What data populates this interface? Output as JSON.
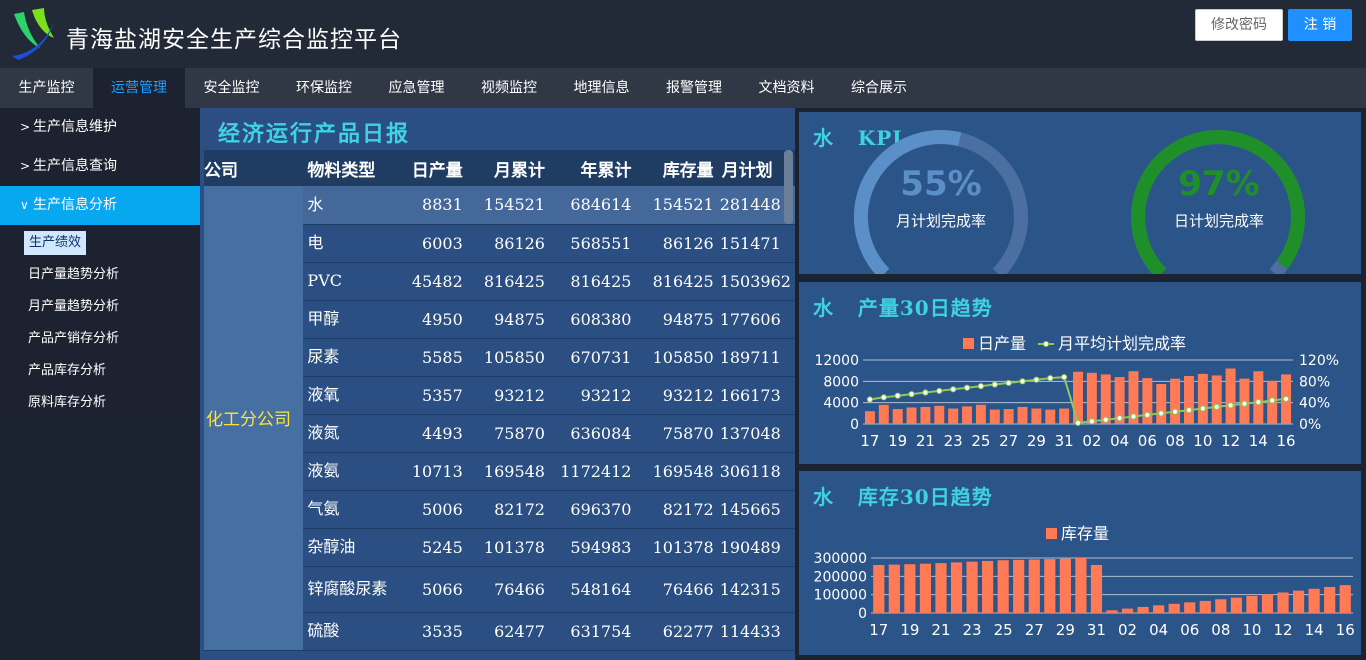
{
  "header": {
    "title": "青海盐湖安全生产综合监控平台",
    "btn_pwd": "修改密码",
    "btn_logout": "注 销"
  },
  "nav": [
    "生产监控",
    "运营管理",
    "安全监控",
    "环保监控",
    "应急管理",
    "视频监控",
    "地理信息",
    "报警管理",
    "文档资料",
    "综合展示"
  ],
  "sidebar": {
    "groups": [
      "生产信息维护",
      "生产信息查询",
      "生产信息分析"
    ],
    "sub": [
      "生产绩效",
      "日产量趋势分析",
      "月产量趋势分析",
      "产品产销存分析",
      "产品库存分析",
      "原料库存分析"
    ]
  },
  "report": {
    "title": "经济运行产品日报",
    "columns": [
      "公司",
      "物料类型",
      "日产量",
      "月累计",
      "年累计",
      "库存量",
      "月计划"
    ],
    "company": "化工分公司",
    "rows": [
      [
        "水",
        "8831",
        "154521",
        "684614",
        "154521",
        "281448"
      ],
      [
        "电",
        "6003",
        "86126",
        "568551",
        "86126",
        "151471"
      ],
      [
        "PVC",
        "45482",
        "816425",
        "816425",
        "816425",
        "1503962"
      ],
      [
        "甲醇",
        "4950",
        "94875",
        "608380",
        "94875",
        "177606"
      ],
      [
        "尿素",
        "5585",
        "105850",
        "670731",
        "105850",
        "189711"
      ],
      [
        "液氧",
        "5357",
        "93212",
        "93212",
        "93212",
        "166173"
      ],
      [
        "液氮",
        "4493",
        "75870",
        "636084",
        "75870",
        "137048"
      ],
      [
        "液氨",
        "10713",
        "169548",
        "1172412",
        "169548",
        "306118"
      ],
      [
        "气氨",
        "5006",
        "82172",
        "696370",
        "82172",
        "145665"
      ],
      [
        "杂醇油",
        "5245",
        "101378",
        "594983",
        "101378",
        "190489"
      ],
      [
        "锌腐酸尿素",
        "5066",
        "76466",
        "548164",
        "76466",
        "142315"
      ],
      [
        "硫酸",
        "3535",
        "62477",
        "631754",
        "62277",
        "114433"
      ]
    ]
  },
  "kpi": {
    "title": "水   KPI",
    "gauges": [
      {
        "value": "55%",
        "label": "月计划完成率",
        "fraction": 0.55,
        "color": "#5b8fc7",
        "track": "#4a6fa0"
      },
      {
        "value": "97%",
        "label": "日计划完成率",
        "fraction": 0.97,
        "color": "#1f8f2a",
        "track": "#4a6fa0"
      }
    ]
  },
  "chart_data": [
    {
      "type": "bar",
      "title": "水   产量30日趋势",
      "legend": [
        "日产量",
        "月平均计划完成率"
      ],
      "categories": [
        "17",
        "18",
        "19",
        "20",
        "21",
        "22",
        "23",
        "24",
        "25",
        "26",
        "27",
        "28",
        "29",
        "30",
        "31",
        "01",
        "02",
        "03",
        "04",
        "05",
        "06",
        "07",
        "08",
        "09",
        "10",
        "11",
        "12",
        "13",
        "14",
        "15",
        "16"
      ],
      "tick_labels": [
        "17",
        "19",
        "21",
        "23",
        "25",
        "27",
        "29",
        "31",
        "02",
        "04",
        "06",
        "08",
        "10",
        "12",
        "14",
        "16"
      ],
      "series": [
        {
          "name": "日产量",
          "type": "bar",
          "color": "#ff7a55",
          "values": [
            2400,
            3600,
            2800,
            3100,
            3200,
            3400,
            2900,
            3300,
            3600,
            2700,
            2800,
            3200,
            2900,
            2700,
            2900,
            9800,
            9600,
            9300,
            8800,
            9900,
            8600,
            7500,
            8500,
            9000,
            9400,
            9100,
            10400,
            8500,
            9900,
            8100,
            9300
          ]
        },
        {
          "name": "月平均计划完成率",
          "type": "line",
          "color": "#8fc85a",
          "values": [
            46,
            50,
            53,
            56,
            59,
            62,
            65,
            68,
            71,
            74,
            77,
            80,
            83,
            86,
            88,
            2,
            5,
            8,
            11,
            14,
            17,
            20,
            23,
            26,
            29,
            32,
            35,
            38,
            41,
            44,
            47
          ]
        }
      ],
      "ylim": [
        0,
        12000
      ],
      "yticks": [
        0,
        4000,
        8000,
        12000
      ],
      "y2lim": [
        0,
        120
      ],
      "y2ticks": [
        "0%",
        "40%",
        "80%",
        "120%"
      ]
    },
    {
      "type": "bar",
      "title": "水   库存30日趋势",
      "legend": [
        "库存量"
      ],
      "categories": [
        "17",
        "18",
        "19",
        "20",
        "21",
        "22",
        "23",
        "24",
        "25",
        "26",
        "27",
        "28",
        "29",
        "30",
        "31",
        "01",
        "02",
        "03",
        "04",
        "05",
        "06",
        "07",
        "08",
        "09",
        "10",
        "11",
        "12",
        "13",
        "14",
        "15",
        "16"
      ],
      "tick_labels": [
        "17",
        "19",
        "21",
        "23",
        "25",
        "27",
        "29",
        "31",
        "02",
        "04",
        "06",
        "08",
        "10",
        "12",
        "14",
        "16"
      ],
      "series": [
        {
          "name": "库存量",
          "type": "bar",
          "color": "#ff7a55",
          "values": [
            262000,
            264000,
            266000,
            269000,
            272000,
            276000,
            280000,
            284000,
            288000,
            290000,
            292000,
            294000,
            296000,
            300000,
            262000,
            15000,
            24000,
            33000,
            42000,
            50000,
            58000,
            66000,
            75000,
            84000,
            93000,
            102000,
            112000,
            122000,
            132000,
            142000,
            152000
          ]
        }
      ],
      "ylim": [
        0,
        300000
      ],
      "yticks": [
        0,
        100000,
        200000,
        300000
      ]
    }
  ]
}
